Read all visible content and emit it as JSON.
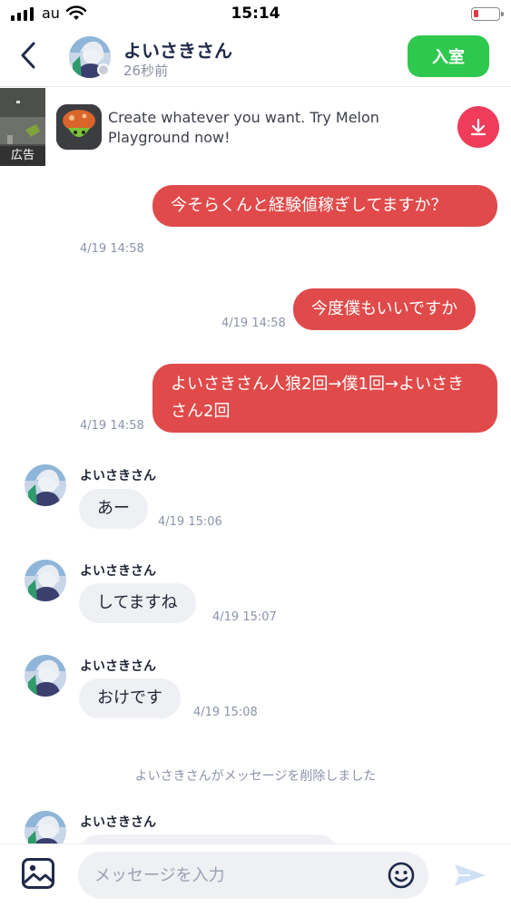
{
  "status_bar": {
    "carrier": "au",
    "time": "15:14",
    "icons": [
      "signal-icon",
      "wifi-icon",
      "battery-icon"
    ]
  },
  "header": {
    "name": "よいさきさん",
    "last_seen": "26秒前",
    "enter_button": "入室",
    "icons": [
      "back-chevron-icon"
    ]
  },
  "ad": {
    "label": "広告",
    "text": "Create whatever you want. Try Melon Playground now!",
    "icons": [
      "download-icon"
    ]
  },
  "messages": [
    {
      "direction": "out",
      "text": "今そらくんと経験値稼ぎしてますか？",
      "time": "4/19 14:58"
    },
    {
      "direction": "out",
      "text": "今度僕もいいですか",
      "time": "4/19 14:58"
    },
    {
      "direction": "out",
      "text": "よいさきさん人狼2回→僕1回→よいさきさん2回",
      "time": "4/19 14:58"
    },
    {
      "direction": "in",
      "sender": "よいさきさん",
      "text": "あー",
      "time": "4/19 15:06"
    },
    {
      "direction": "in",
      "sender": "よいさきさん",
      "text": "してますね",
      "time": "4/19 15:07"
    },
    {
      "direction": "in",
      "sender": "よいさきさん",
      "text": "おけです",
      "time": "4/19 15:08"
    },
    {
      "direction": "in",
      "sender": "よいさきさん"
    }
  ],
  "system_message": "よいさきさんがメッセージを削除しました",
  "composer": {
    "placeholder": "メッセージを入力",
    "icons": [
      "image-icon",
      "emoji-icon",
      "send-icon"
    ]
  },
  "colors": {
    "outgoing_bubble": "#e04a4a",
    "incoming_bubble": "#eef0f3",
    "enter_button": "#2fc84f",
    "download_button": "#ee3c5a"
  }
}
